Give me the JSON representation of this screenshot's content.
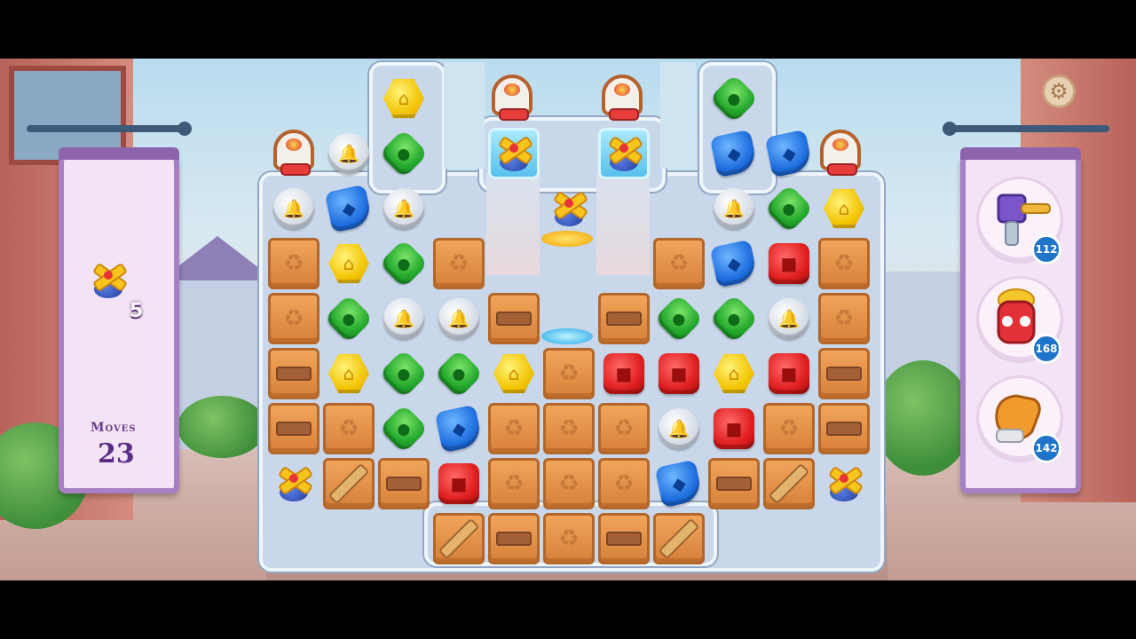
{
  "goal": {
    "icon": "propeller-toy-plus-icon",
    "count": "5"
  },
  "moves": {
    "label": "Moves",
    "value": "23"
  },
  "boosters": [
    {
      "name": "hammer",
      "icon": "hammer-icon",
      "count": "112"
    },
    {
      "name": "fire-hydrant",
      "icon": "hydrant-icon",
      "count": "168"
    },
    {
      "name": "glove",
      "icon": "glove-icon",
      "count": "142"
    }
  ],
  "settings": {
    "icon": "gear-icon"
  },
  "colors": {
    "banner": "#a77fc2",
    "badge": "#1f73c9",
    "crate": "#e8913f"
  },
  "board": {
    "rows": [
      [
        "void",
        "void",
        "Y",
        "void",
        "void",
        "void",
        "void",
        "void",
        "G",
        "void",
        "void"
      ],
      [
        "T",
        "W",
        "G",
        "void",
        "ice",
        "void",
        "ice",
        "void",
        "B",
        "B",
        "T"
      ],
      [
        "W",
        "B",
        "W",
        "void",
        "void",
        "X",
        "void",
        "void",
        "W",
        "G",
        "Y"
      ],
      [
        "C",
        "Y",
        "G",
        "C",
        "void",
        "void",
        "void",
        "C",
        "B",
        "R",
        "C"
      ],
      [
        "C",
        "G",
        "W",
        "W",
        "P",
        "void",
        "P",
        "G",
        "G",
        "W",
        "C"
      ],
      [
        "P",
        "Y",
        "G",
        "G",
        "Y",
        "C",
        "R",
        "R",
        "Y",
        "R",
        "P"
      ],
      [
        "P",
        "C",
        "G",
        "B",
        "C",
        "C",
        "C",
        "W",
        "R",
        "C",
        "P"
      ],
      [
        "X",
        "D",
        "P",
        "R",
        "C",
        "C",
        "C",
        "B",
        "P",
        "D",
        "X"
      ],
      [
        "void",
        "void",
        "void",
        "D",
        "P",
        "C",
        "P",
        "D",
        "void",
        "void",
        "void"
      ]
    ]
  }
}
